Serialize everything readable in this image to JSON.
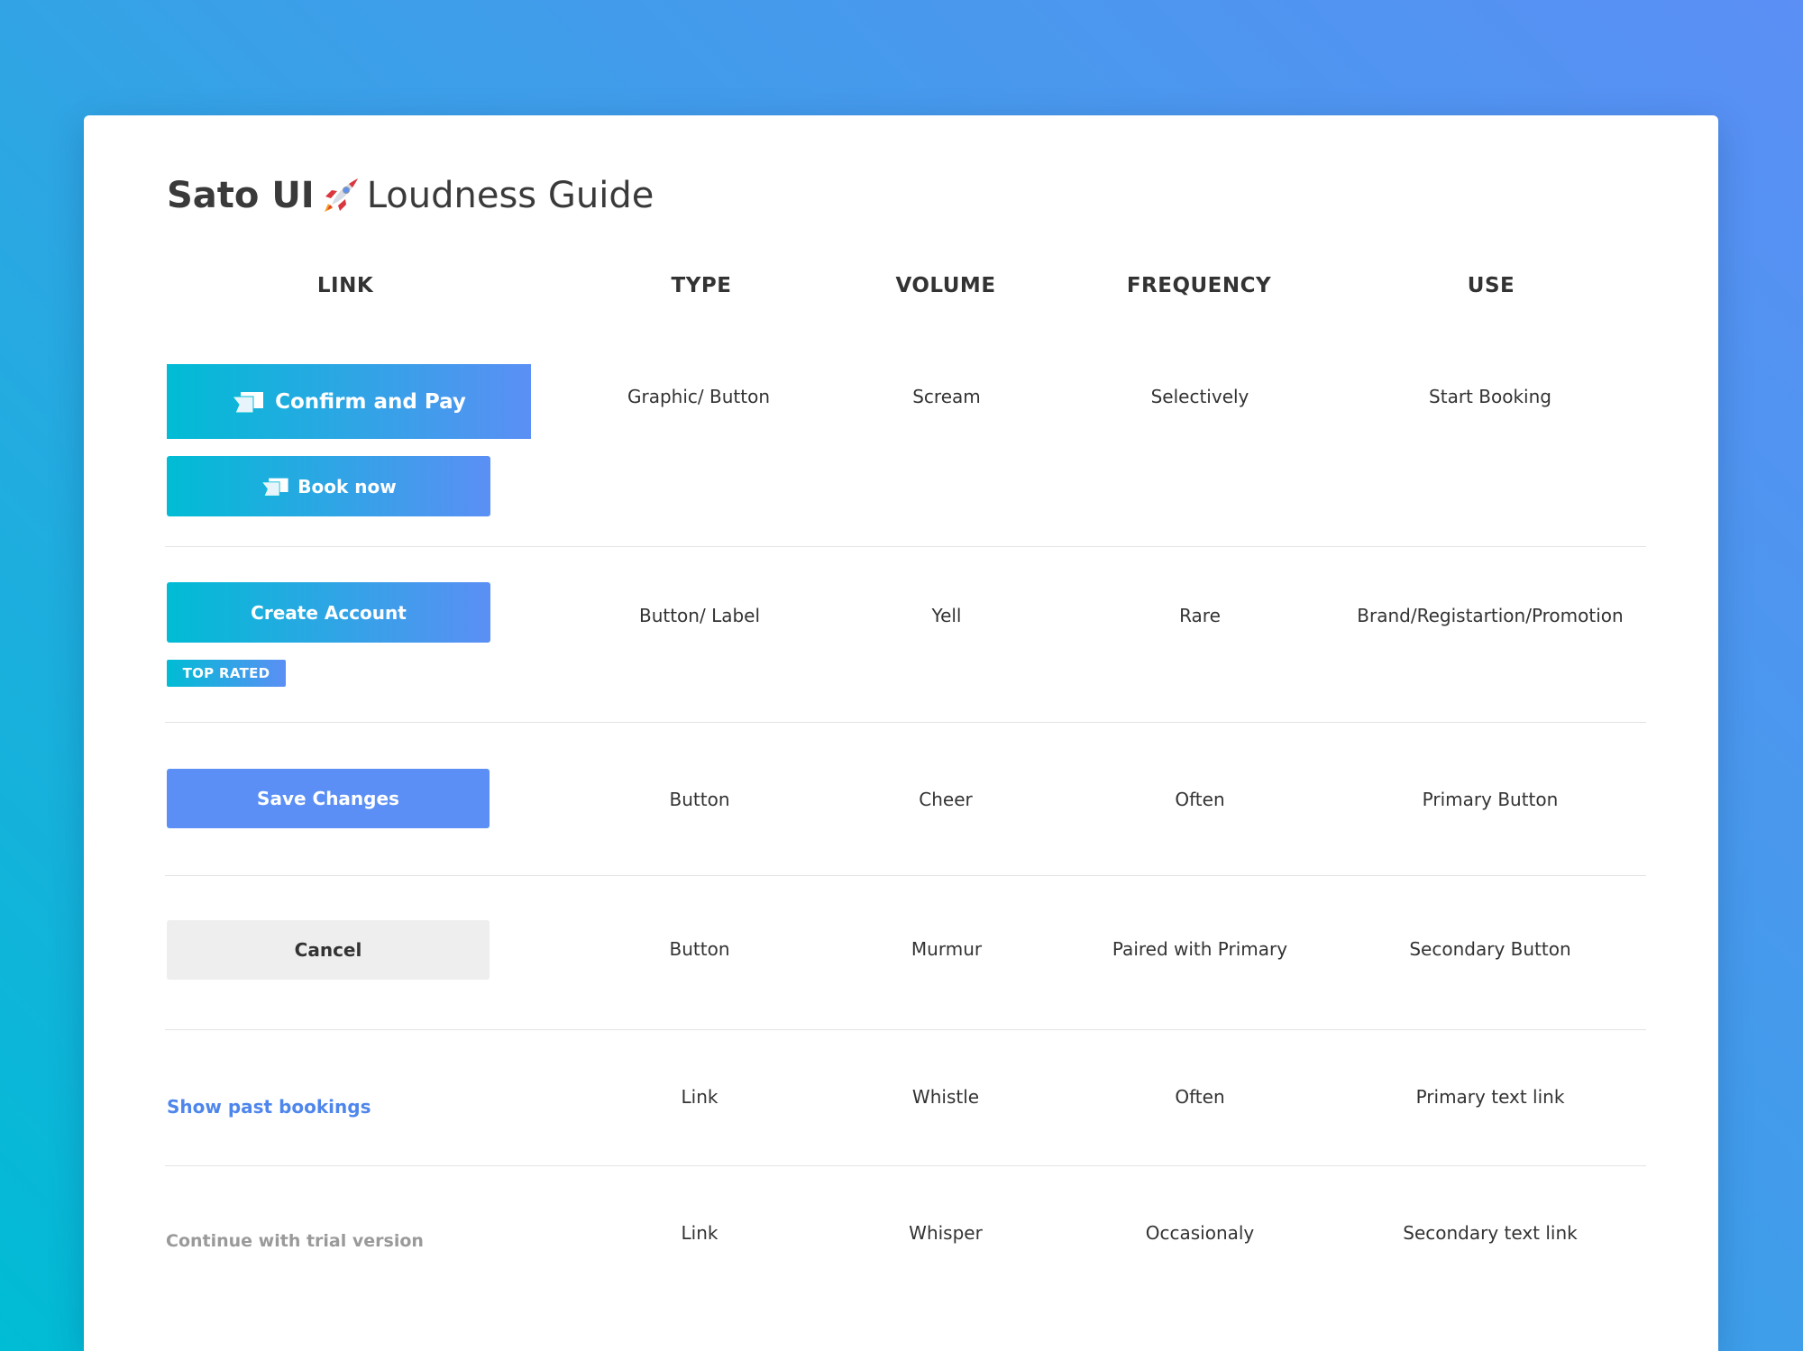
{
  "title": {
    "brand": "Sato UI",
    "icon": "rocket-icon",
    "subtitle": "Loudness Guide"
  },
  "columns": [
    "LINK",
    "TYPE",
    "VOLUME",
    "FREQUENCY",
    "USE"
  ],
  "examples": {
    "confirm_pay": "Confirm and Pay",
    "book_now": "Book now",
    "create_account": "Create Account",
    "top_rated": "TOP RATED",
    "save_changes": "Save Changes",
    "cancel": "Cancel",
    "show_past_bookings": "Show past bookings",
    "continue_trial": "Continue with trial version"
  },
  "rows": [
    {
      "type": "Graphic/ Button",
      "volume": "Scream",
      "frequency": "Selectively",
      "use": "Start Booking"
    },
    {
      "type": "Button/ Label",
      "volume": "Yell",
      "frequency": "Rare",
      "use": "Brand/Registartion/Promotion"
    },
    {
      "type": "Button",
      "volume": "Cheer",
      "frequency": "Often",
      "use": "Primary Button"
    },
    {
      "type": "Button",
      "volume": "Murmur",
      "frequency": "Paired with Primary",
      "use": "Secondary Button"
    },
    {
      "type": "Link",
      "volume": "Whistle",
      "frequency": "Often",
      "use": "Primary text link"
    },
    {
      "type": "Link",
      "volume": "Whisper",
      "frequency": "Occasionaly",
      "use": "Secondary text link"
    }
  ],
  "colors": {
    "gradient_start": "#00bcd4",
    "gradient_end": "#5b8ff5",
    "primary_blue": "#5b8ff5",
    "link_blue": "#4f86ec",
    "secondary_gray": "#9a9a9a",
    "cancel_bg": "#eeeeee"
  }
}
